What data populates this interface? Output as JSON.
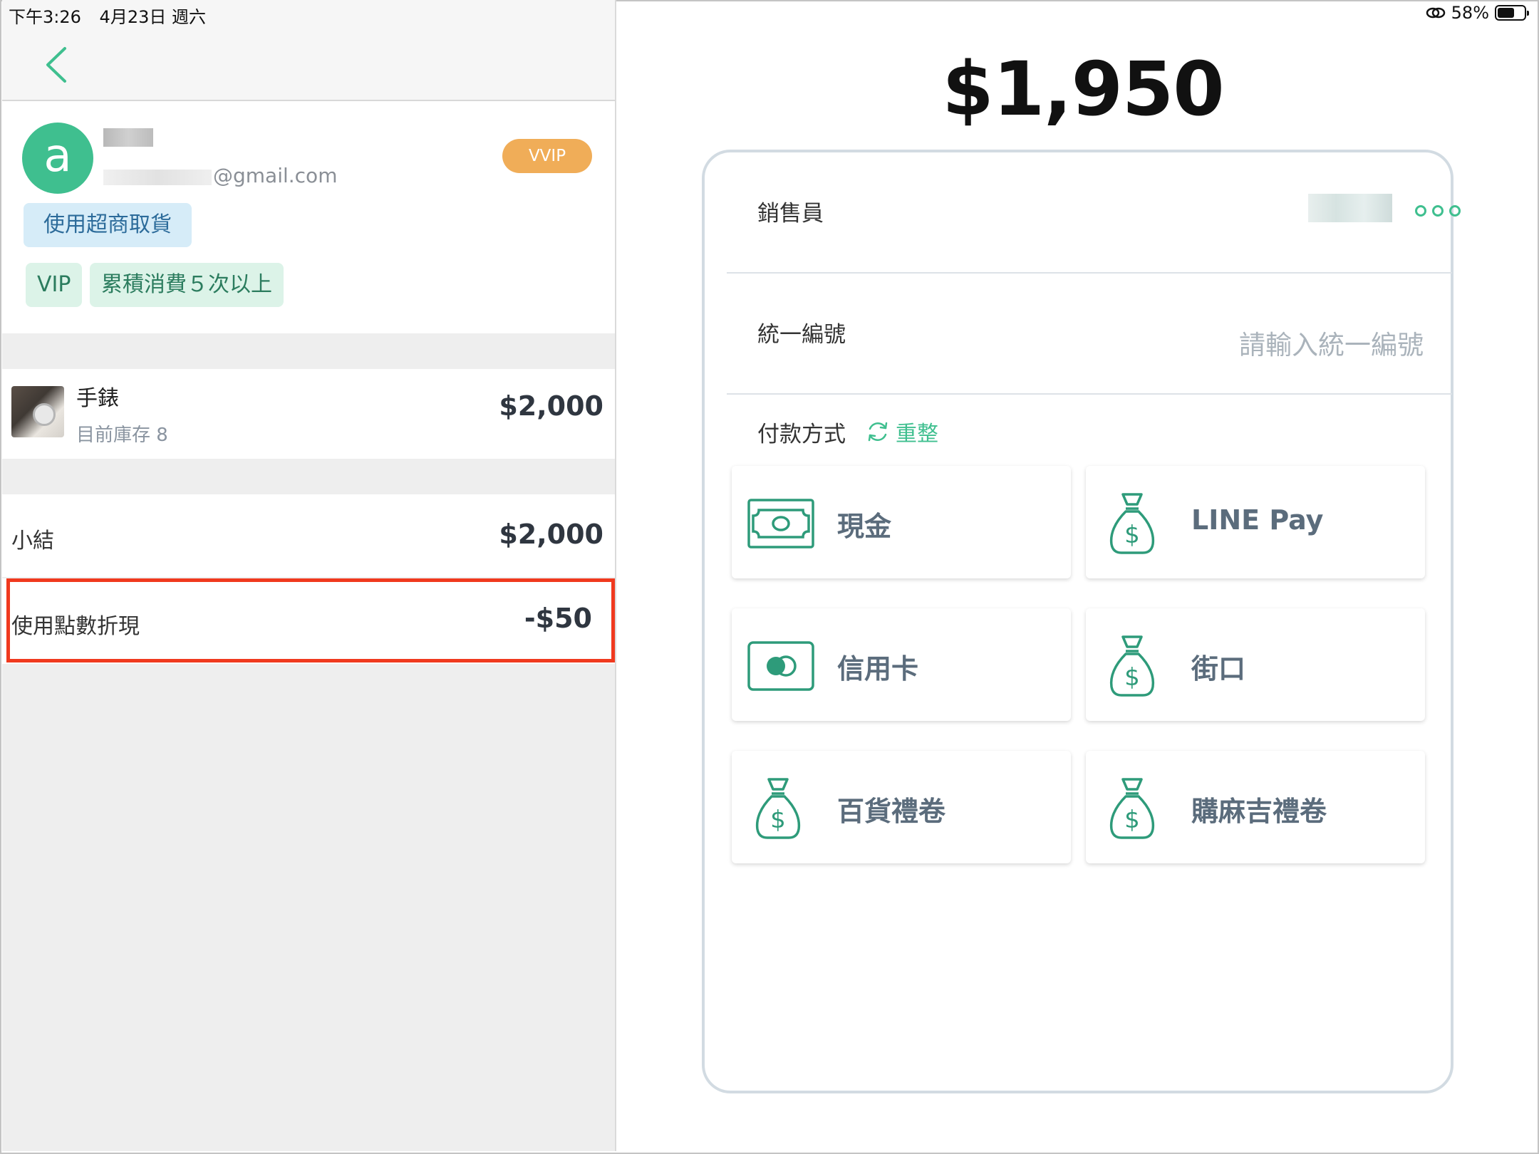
{
  "status_bar": {
    "time": "下午3:26",
    "date": "4月23日 週六",
    "battery": "58%",
    "battery_level": 0.58
  },
  "customer": {
    "avatar_letter": "a",
    "email_domain": "@gmail.com",
    "level_badge": "VVIP",
    "tags": {
      "pickup": "使用超商取貨",
      "vip": "VIP",
      "loyal": "累積消費５次以上"
    }
  },
  "cart": {
    "item": {
      "name": "手錶",
      "stock": "目前庫存 8",
      "price": "$2,000"
    },
    "subtotal": {
      "label": "小結",
      "value": "$2,000"
    },
    "points": {
      "label": "使用點數折現",
      "value": "-$50"
    }
  },
  "checkout": {
    "total": "$1,950",
    "salesperson_label": "銷售員",
    "tax_id_label": "統一編號",
    "tax_id_placeholder": "請輸入統一編號",
    "payment_label": "付款方式",
    "reset_label": "重整",
    "methods": [
      {
        "label": "現金",
        "icon": "cash-icon"
      },
      {
        "label": "LINE Pay",
        "icon": "money-bag-icon"
      },
      {
        "label": "信用卡",
        "icon": "credit-card-icon"
      },
      {
        "label": "街口",
        "icon": "money-bag-icon"
      },
      {
        "label": "百貨禮卷",
        "icon": "money-bag-icon"
      },
      {
        "label": "購麻吉禮卷",
        "icon": "money-bag-icon"
      }
    ]
  },
  "colors": {
    "accent": "#3fbf8f",
    "vvip": "#f0ad58",
    "highlight": "#f0391e"
  }
}
